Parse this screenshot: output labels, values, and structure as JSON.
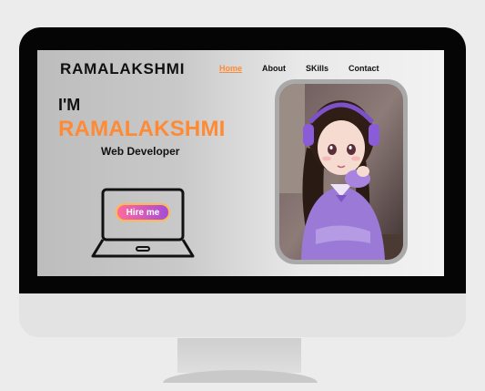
{
  "site": {
    "brand": "RAMALAKSHMI",
    "nav": [
      {
        "label": "Home",
        "active": true
      },
      {
        "label": "About",
        "active": false
      },
      {
        "label": "SKills",
        "active": false
      },
      {
        "label": "Contact",
        "active": false
      }
    ]
  },
  "hero": {
    "intro": "I'M",
    "name": "RAMALAKSHMI",
    "role": "Web Developer",
    "cta": "Hire me"
  },
  "colors": {
    "accent": "#ff8a35",
    "button_gradient_start": "#ff6a9a",
    "button_gradient_end": "#a44cd9",
    "button_border": "#ffb84d",
    "bezel": "#050505"
  }
}
